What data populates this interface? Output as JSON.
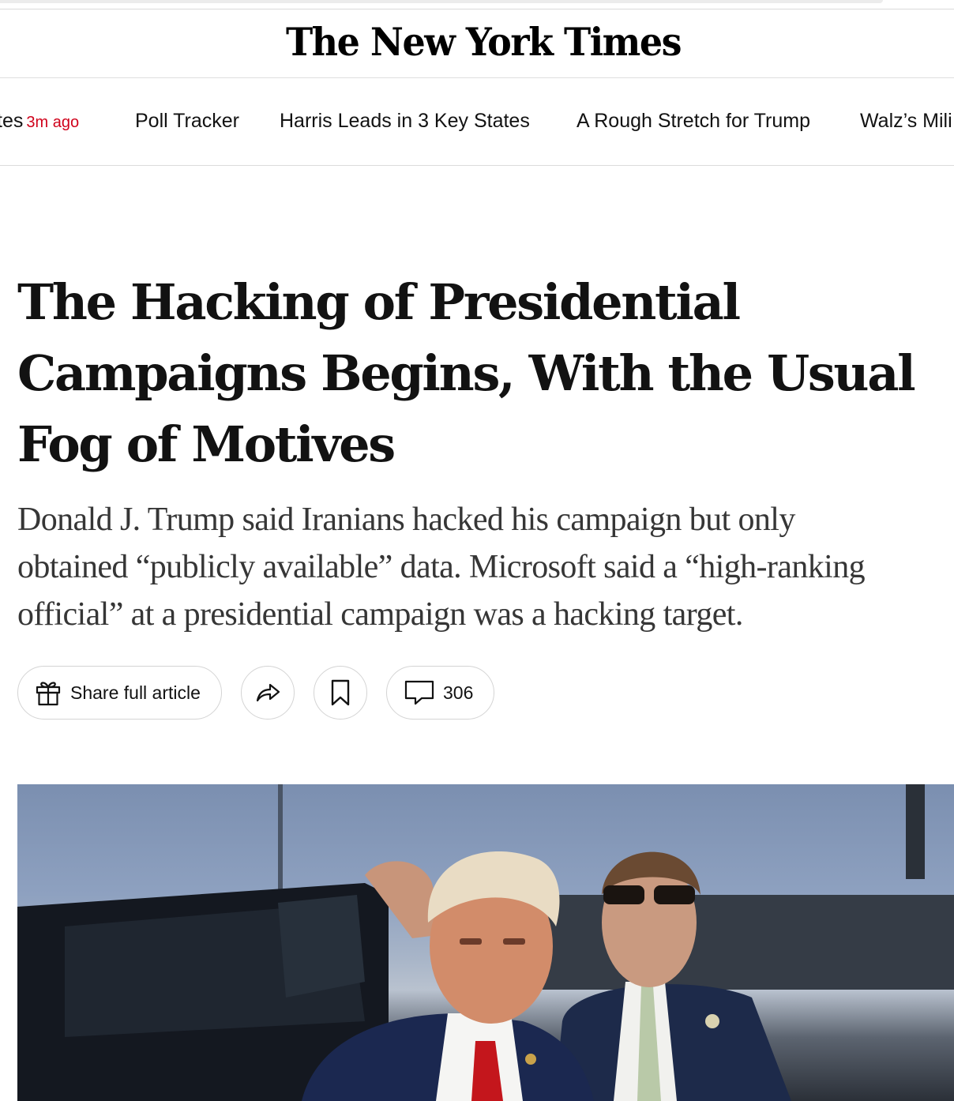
{
  "masthead": {
    "logo_text": "The New York Times"
  },
  "nav": {
    "items": [
      {
        "label": "tes",
        "time": "3m ago"
      },
      {
        "label": "Poll Tracker"
      },
      {
        "label": "Harris Leads in 3 Key States"
      },
      {
        "label": "A Rough Stretch for Trump"
      },
      {
        "label": "Walz’s Mili"
      }
    ]
  },
  "article": {
    "headline": "The Hacking of Presidential Campaigns Begins, With the Usual Fog of Motives",
    "summary": "Donald J. Trump said Iranians hacked his campaign but only\nobtained “publicly available” data. Microsoft said a “high-ranking\nofficial” at a presidential campaign was a hacking target."
  },
  "actions": {
    "share_full_label": "Share full article",
    "comments_count": "306",
    "icons": {
      "gift": "gift-icon",
      "share": "share-arrow-icon",
      "save": "bookmark-icon",
      "comments": "comment-bubble-icon"
    }
  },
  "colors": {
    "accent_time": "#d0021b",
    "text": "#121212",
    "summary_text": "#363636",
    "border": "#d4d4d4"
  }
}
